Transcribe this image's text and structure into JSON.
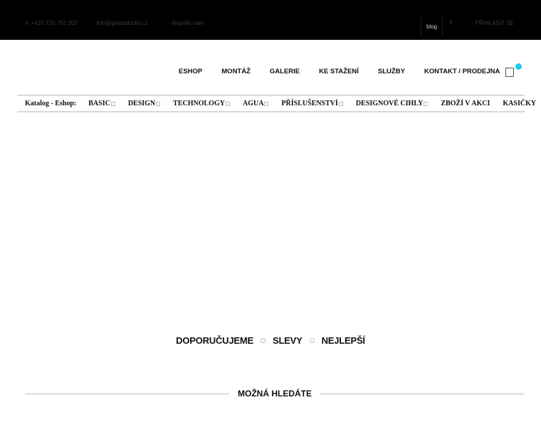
{
  "topbar": {
    "phone": "+420 725 753 353",
    "email": "info@glassblocks.cz",
    "write_us": "Napište nám",
    "blog": "blog",
    "facebook": "f",
    "login": "PŘIHLÁSIT SE",
    "icons": {
      "phone": "phone-icon",
      "email": "envelope-icon",
      "write_us": "chat-icon",
      "login": "user-icon"
    }
  },
  "nav": {
    "items": [
      "ESHOP",
      "MONTÁŽ",
      "GALERIE",
      "KE STAŽENÍ",
      "SLUŽBY",
      "KONTAKT / PRODEJNA"
    ]
  },
  "cart": {
    "icon": "cart-icon",
    "badge_color": "#1ec8f0"
  },
  "catalog": {
    "label": "Katalog - Eshop:",
    "items": [
      {
        "label": "BASIC",
        "has_dropdown": true
      },
      {
        "label": "DESIGN",
        "has_dropdown": true
      },
      {
        "label": "TECHNOLOGY",
        "has_dropdown": true
      },
      {
        "label": "AGUA",
        "has_dropdown": true
      },
      {
        "label": "PŘÍSLUŠENSTVÍ",
        "has_dropdown": true
      },
      {
        "label": "DESIGNOVÉ CIHLY",
        "has_dropdown": true
      },
      {
        "label": "ZBOŽÍ V AKCI",
        "has_dropdown": false
      },
      {
        "label": "KASIČKY",
        "has_dropdown": false
      }
    ]
  },
  "tabs": [
    "DOPORUČUJEME",
    "SLEVY",
    "NEJLEPŠÍ"
  ],
  "section": {
    "title": "MOŽNÁ HLEDÁTE"
  }
}
